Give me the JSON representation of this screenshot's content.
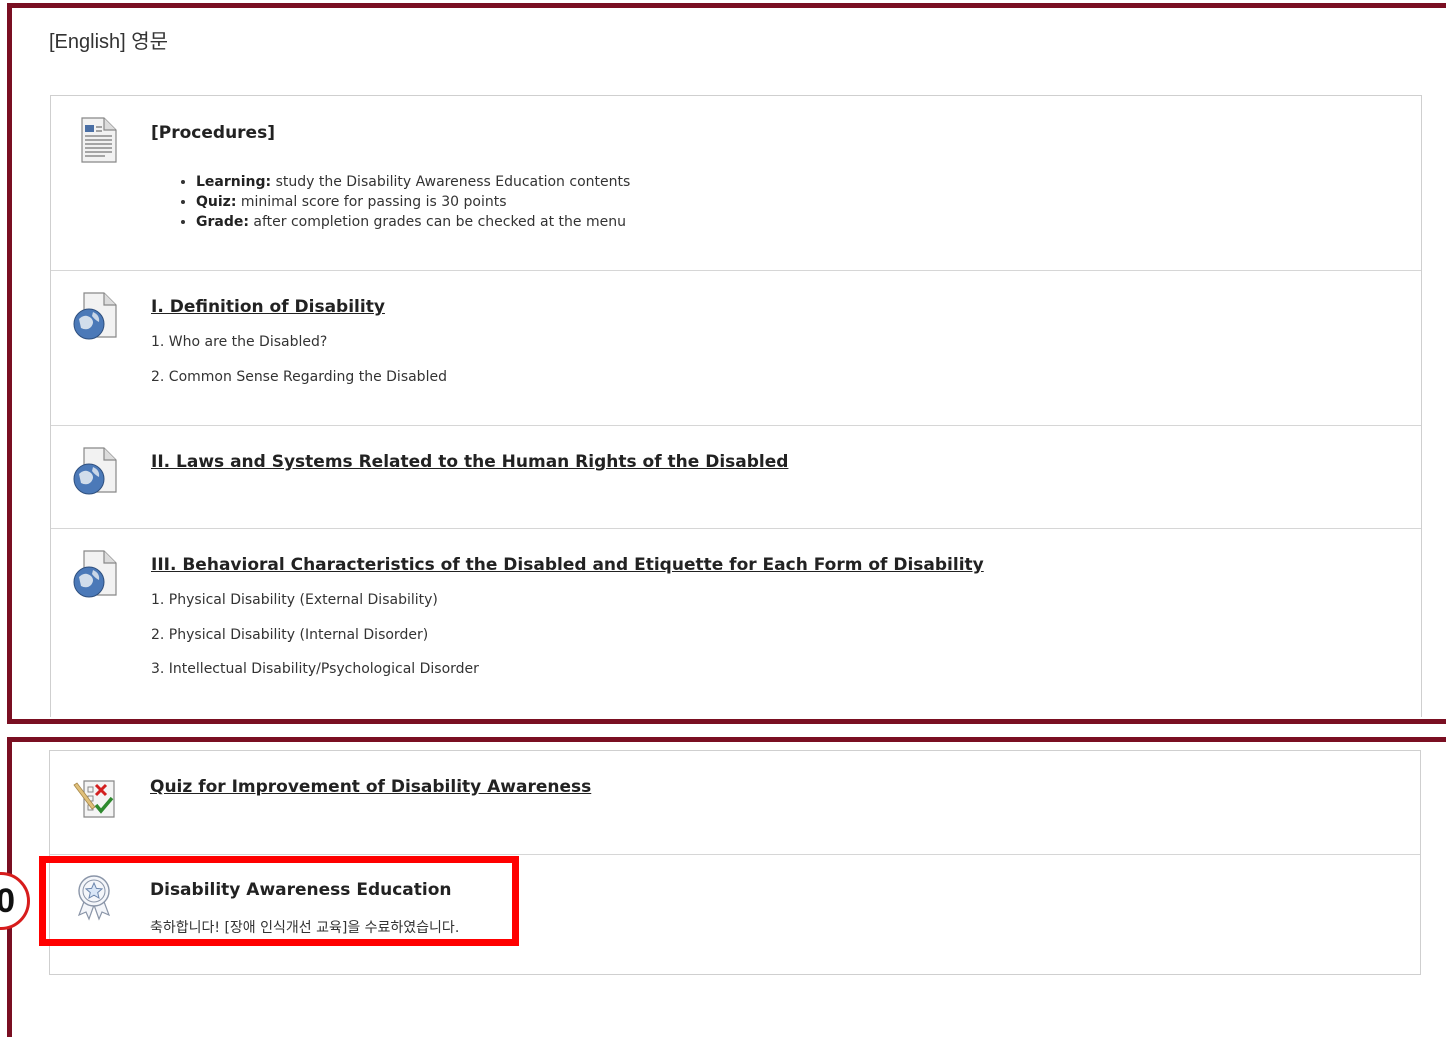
{
  "section_title": "[English] 영문",
  "items": [
    {
      "title": "[Procedures]",
      "bullets": [
        {
          "label": "Learning:",
          "text": " study the Disability Awareness Education contents"
        },
        {
          "label": "Quiz:",
          "text": " minimal score for passing is 30 points"
        },
        {
          "label": "Grade:",
          "text": " after completion grades can be checked at the menu"
        }
      ]
    },
    {
      "title": "I. Definition of Disability",
      "lines": [
        "1. Who are the Disabled?",
        "2. Common Sense Regarding the Disabled"
      ]
    },
    {
      "title": "II. Laws and Systems Related to the Human Rights of the Disabled"
    },
    {
      "title": "III. Behavioral Characteristics of the Disabled and Etiquette for Each Form of Disability",
      "lines": [
        "1. Physical Disability (External Disability)",
        "2.  Physical Disability (Internal Disorder)",
        "3. Intellectual Disability/Psychological Disorder"
      ]
    },
    {
      "title": "Quiz for Improvement of Disability Awareness"
    },
    {
      "title": "Disability Awareness Education",
      "lines": [
        "축하합니다! [장애 인식개선 교육]을 수료하였습니다."
      ]
    }
  ],
  "marker_label": "0",
  "colors": {
    "frame": "#7a0f22",
    "highlight": "#ff0000",
    "text": "#222222"
  },
  "icons": [
    "document-icon",
    "web-link-icon",
    "web-link-icon",
    "web-link-icon",
    "quiz-icon",
    "badge-icon"
  ]
}
